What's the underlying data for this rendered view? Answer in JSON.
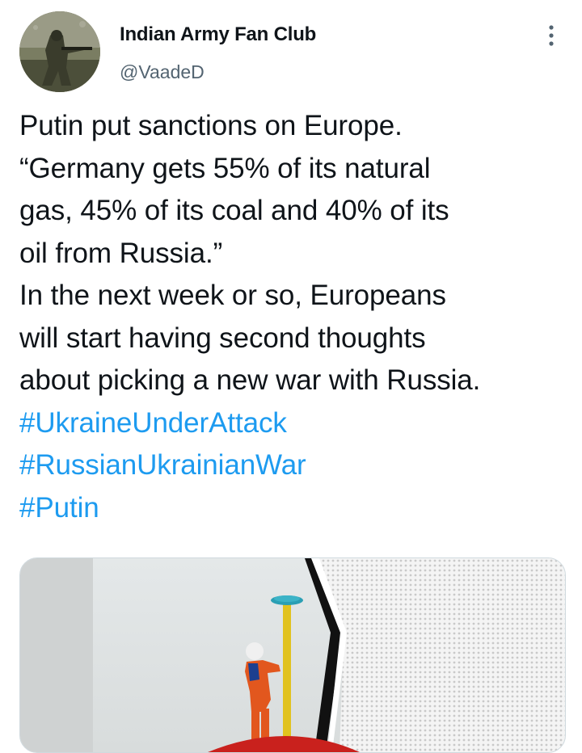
{
  "tweet": {
    "author": {
      "display_name": "Indian Army Fan Club",
      "handle": "@VaadeD",
      "avatar_icon": "soldier-photo-avatar"
    },
    "more_icon": "more-vertical-icon",
    "text_lines": [
      "Putin put sanctions on Europe.",
      "“Germany gets 55% of its natural",
      "gas, 45% of its coal and 40% of its",
      "oil from Russia.”",
      "In the next week or so, Europeans",
      "will start having second thoughts",
      "about picking a new war with Russia."
    ],
    "hashtags": [
      "#UkraineUnderAttack",
      "#RussianUkrainianWar",
      "#Putin"
    ],
    "media": {
      "kind": "photo",
      "description_icon": "pipeline-worker-photo"
    },
    "colors": {
      "link": "#1d9bf0",
      "secondary": "#536471",
      "text": "#0f1419"
    }
  }
}
